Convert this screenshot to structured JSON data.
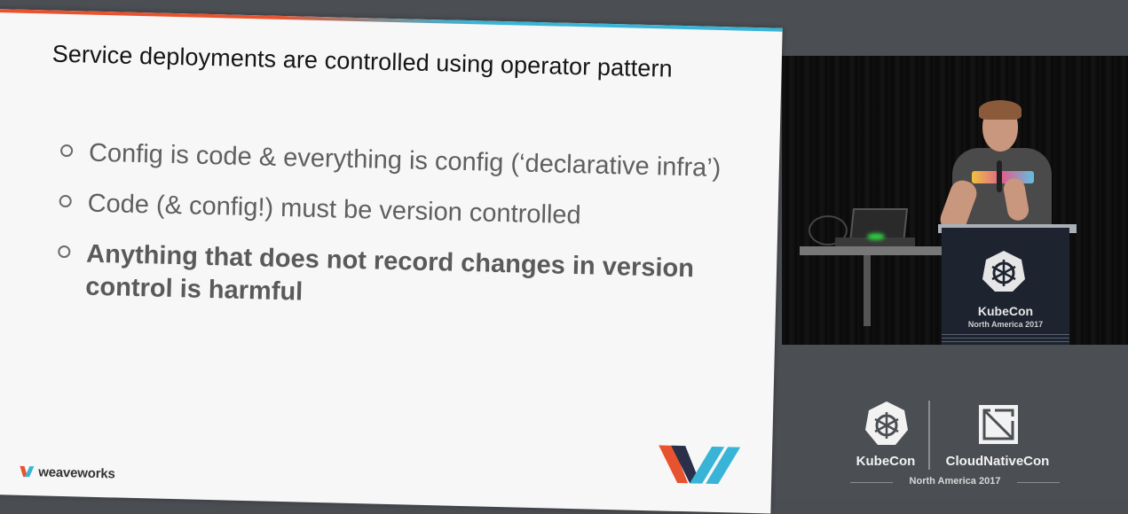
{
  "slide": {
    "title": "Service deployments are controlled using operator pattern",
    "bullets": [
      {
        "text": "Config is code & everything is config (‘declarative infra’)",
        "bold": false
      },
      {
        "text": "Code (& config!) must be version controlled",
        "bold": false
      },
      {
        "text": "Anything that does not record changes in version control is harmful",
        "bold": true
      }
    ],
    "footer_logo_text": "weaveworks"
  },
  "video": {
    "podium_name": "KubeCon",
    "podium_subtitle": "North America 2017"
  },
  "branding": {
    "kubecon": "KubeCon",
    "cloudnativecon": "CloudNativeCon",
    "region": "North America 2017"
  },
  "colors": {
    "accent_orange": "#e8532f",
    "accent_blue": "#39b4d6",
    "frame_gray": "#4b4e53"
  }
}
